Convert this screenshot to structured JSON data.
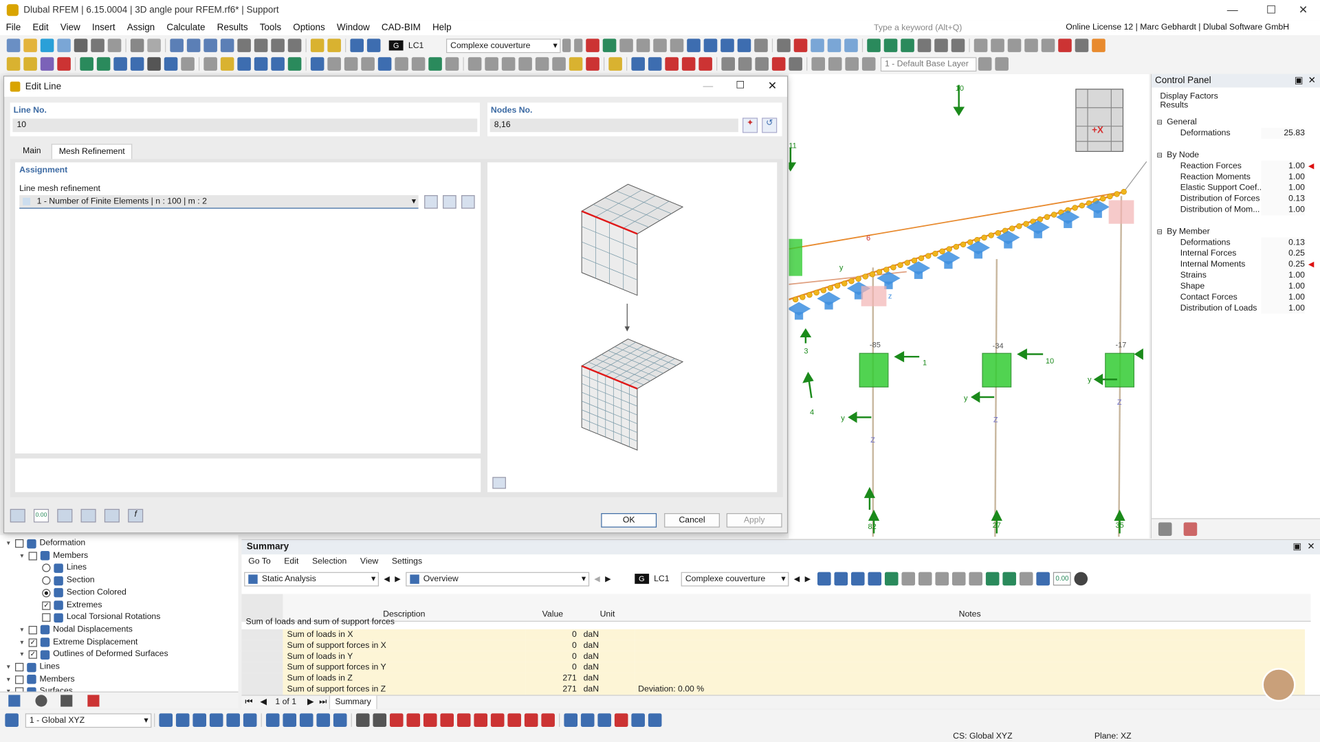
{
  "app": {
    "title": "Dlubal RFEM | 6.15.0004 | 3D angle pour RFEM.rf6* | Support",
    "search_placeholder": "Type a keyword (Alt+Q)",
    "license": "Online License 12 | Marc Gebhardt | Dlubal Software GmbH"
  },
  "menu": [
    "File",
    "Edit",
    "View",
    "Insert",
    "Assign",
    "Calculate",
    "Results",
    "Tools",
    "Options",
    "Window",
    "CAD-BIM",
    "Help"
  ],
  "toolbar": {
    "lc_chip": "G",
    "lc": "LC1",
    "load_case": "Complexe couverture",
    "layer": "1 - Default Base Layer"
  },
  "dialog": {
    "title": "Edit Line",
    "line_no_label": "Line No.",
    "line_no": "10",
    "nodes_no_label": "Nodes No.",
    "nodes_no": "8,16",
    "tabs": [
      "Main",
      "Mesh Refinement"
    ],
    "active_tab": "Mesh Refinement",
    "assignment_label": "Assignment",
    "refinement_label": "Line mesh refinement",
    "refinement_value": "1 - Number of Finite Elements | n : 100 | m : 2",
    "ok": "OK",
    "cancel": "Cancel",
    "apply": "Apply",
    "icon_value": "0.00"
  },
  "control_panel": {
    "title": "Control Panel",
    "subtitle1": "Display Factors",
    "subtitle2": "Results",
    "groups": [
      {
        "name": "General",
        "items": [
          {
            "label": "Deformations",
            "value": "25.83"
          }
        ]
      },
      {
        "name": "By Node",
        "items": [
          {
            "label": "Reaction Forces",
            "value": "1.00"
          },
          {
            "label": "Reaction Moments",
            "value": "1.00"
          },
          {
            "label": "Elastic Support Coef...",
            "value": "1.00"
          },
          {
            "label": "Distribution of Forces",
            "value": "0.13"
          },
          {
            "label": "Distribution of Mom...",
            "value": "1.00"
          }
        ]
      },
      {
        "name": "By Member",
        "items": [
          {
            "label": "Deformations",
            "value": "0.13"
          },
          {
            "label": "Internal Forces",
            "value": "0.25"
          },
          {
            "label": "Internal Moments",
            "value": "0.25"
          },
          {
            "label": "Strains",
            "value": "1.00"
          },
          {
            "label": "Shape",
            "value": "1.00"
          },
          {
            "label": "Contact Forces",
            "value": "1.00"
          },
          {
            "label": "Distribution of Loads",
            "value": "1.00"
          }
        ]
      }
    ]
  },
  "viewport": {
    "labels": [
      "10",
      "11",
      "6",
      "3",
      "4",
      "1",
      "10",
      "-85",
      "-34",
      "-17",
      "82",
      "27",
      "35",
      "y",
      "y",
      "y",
      "y",
      "Z",
      "Z",
      "Z",
      "z",
      "+X"
    ]
  },
  "navigator": {
    "items": [
      {
        "label": "Deformation",
        "level": 0,
        "check": "box"
      },
      {
        "label": "Members",
        "level": 1,
        "check": "box"
      },
      {
        "label": "Lines",
        "level": 2,
        "check": "radio"
      },
      {
        "label": "Section",
        "level": 2,
        "check": "radio"
      },
      {
        "label": "Section Colored",
        "level": 2,
        "check": "radio-on"
      },
      {
        "label": "Extremes",
        "level": 2,
        "check": "checked"
      },
      {
        "label": "Local Torsional Rotations",
        "level": 2,
        "check": "box"
      },
      {
        "label": "Nodal Displacements",
        "level": 1,
        "check": "box"
      },
      {
        "label": "Extreme Displacement",
        "level": 1,
        "check": "checked"
      },
      {
        "label": "Outlines of Deformed Surfaces",
        "level": 1,
        "check": "checked"
      },
      {
        "label": "Lines",
        "level": 0,
        "check": "box"
      },
      {
        "label": "Members",
        "level": 0,
        "check": "box"
      },
      {
        "label": "Surfaces",
        "level": 0,
        "check": "box"
      }
    ]
  },
  "summary": {
    "title": "Summary",
    "menu": [
      "Go To",
      "Edit",
      "Selection",
      "View",
      "Settings"
    ],
    "analysis": "Static Analysis",
    "view": "Overview",
    "lc_chip": "G",
    "lc": "LC1",
    "load_case": "Complexe couverture",
    "headers": [
      "Description",
      "Value",
      "Unit",
      "Notes"
    ],
    "group": "Sum of loads and sum of support forces",
    "rows": [
      {
        "desc": "Sum of loads in X",
        "value": "0",
        "unit": "daN",
        "note": ""
      },
      {
        "desc": "Sum of support forces in X",
        "value": "0",
        "unit": "daN",
        "note": ""
      },
      {
        "desc": "Sum of loads in Y",
        "value": "0",
        "unit": "daN",
        "note": ""
      },
      {
        "desc": "Sum of support forces in Y",
        "value": "0",
        "unit": "daN",
        "note": ""
      },
      {
        "desc": "Sum of loads in Z",
        "value": "271",
        "unit": "daN",
        "note": ""
      },
      {
        "desc": "Sum of support forces in Z",
        "value": "271",
        "unit": "daN",
        "note": "Deviation: 0.00 %"
      }
    ],
    "pager": "1 of 1",
    "tab": "Summary",
    "icon_value": "0.00"
  },
  "status": {
    "cs_combo": "1 - Global XYZ",
    "cs": "CS: Global XYZ",
    "plane": "Plane: XZ"
  },
  "colors": {
    "accent": "#3c6aa3",
    "support": "#33cc33",
    "member": "#e88a2e",
    "hinge": "#3d8fe0"
  }
}
